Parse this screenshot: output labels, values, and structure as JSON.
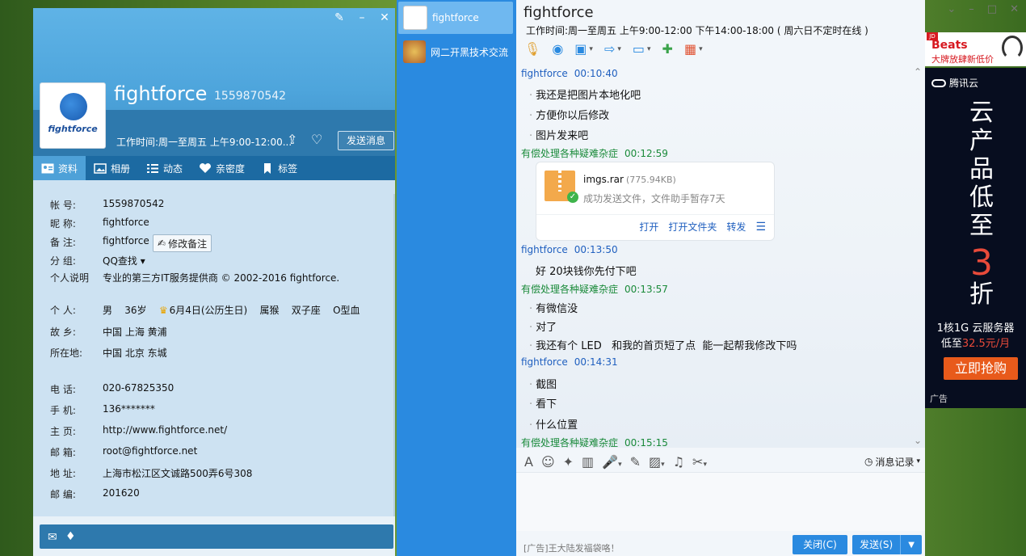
{
  "profile": {
    "name": "fightforce",
    "qq": "1559870542",
    "logo_text": "fightforce",
    "hours": "工作时间:周一至周五 上午9:00-12:00...",
    "send_button": "发送消息",
    "tabs": [
      {
        "label": "资料",
        "icon": "id-card-icon"
      },
      {
        "label": "相册",
        "icon": "photo-icon"
      },
      {
        "label": "动态",
        "icon": "list-icon"
      },
      {
        "label": "亲密度",
        "icon": "heart-icon"
      },
      {
        "label": "标签",
        "icon": "bookmark-icon"
      }
    ],
    "fields": {
      "account": {
        "label": "帐    号:",
        "value": "1559870542"
      },
      "nickname": {
        "label": "昵    称:",
        "value": "fightforce"
      },
      "remark": {
        "label": "备    注:",
        "value": "fightforce"
      },
      "group": {
        "label": "分    组:",
        "value": "QQ查找"
      },
      "bio": {
        "label": "个人说明",
        "value": "专业的第三方IT服务提供商 © 2002-2016 fightforce."
      },
      "personal": {
        "label": "个    人:",
        "gender": "男",
        "age": "36岁",
        "birthday": "6月4日(公历生日)",
        "zodiac": "属猴",
        "sign": "双子座",
        "blood": "O型血"
      },
      "hometown": {
        "label": "故    乡:",
        "value": "中国 上海 黄浦"
      },
      "location": {
        "label": "所在地:",
        "value": "中国 北京 东城"
      },
      "phone": {
        "label": "电    话:",
        "value": "020-67825350"
      },
      "mobile": {
        "label": "手    机:",
        "value": "136*******"
      },
      "homepage": {
        "label": "主    页:",
        "value": "http://www.fightforce.net/"
      },
      "email": {
        "label": "邮    箱:",
        "value": "root@fightforce.net"
      },
      "address": {
        "label": "地    址:",
        "value": "上海市松江区文诚路500弄6号308"
      },
      "postcode": {
        "label": "邮    编:",
        "value": "201620"
      }
    },
    "edit_note_button": "修改备注"
  },
  "sessions": [
    {
      "name": "fightforce",
      "active": true
    },
    {
      "name": "网二开黑技术交流",
      "active": false
    }
  ],
  "chat": {
    "title": "fightforce",
    "hours": "工作时间:周一至周五 上午9:00-12:00 下午14:00-18:00 ( 周六日不定时在线 )",
    "messages": [
      {
        "who": "fightforce",
        "time": "00:10:40",
        "lines": [
          "我还是把图片本地化吧",
          "方便你以后修改",
          "图片发来吧"
        ]
      },
      {
        "who": "有偿处理各种疑难杂症",
        "time": "00:12:59"
      },
      {
        "who": "fightforce",
        "time": "00:13:50",
        "lines": [
          "好 20块钱你先付下吧"
        ]
      },
      {
        "who": "有偿处理各种疑难杂症",
        "time": "00:13:57",
        "lines": [
          "有微信没",
          "对了",
          "我还有个 LED   和我的首页短了点  能一起帮我修改下吗"
        ]
      },
      {
        "who": "fightforce",
        "time": "00:14:31",
        "lines": [
          "截图",
          "看下",
          "什么位置"
        ]
      },
      {
        "who": "有偿处理各种疑难杂症",
        "time": "00:15:15"
      }
    ],
    "file": {
      "name": "imgs.rar",
      "size": "(775.94KB)",
      "status": "成功发送文件，文件助手暂存7天",
      "actions": [
        "打开",
        "打开文件夹",
        "转发"
      ]
    },
    "history_label": "消息记录",
    "ad_text": "[广告]王大陆发福袋咯！",
    "close_button": "关闭(C)",
    "send_button": "发送(S)"
  },
  "ads": {
    "top": {
      "brand": "Beats",
      "tagline": "大牌放肆新低价",
      "jd": "JD"
    },
    "main": {
      "logo": "腾讯云",
      "slogan": [
        "云",
        "产",
        "品",
        "低",
        "至"
      ],
      "discount": "3",
      "unit": "折",
      "spec_line1": "1核1G 云服务器",
      "spec_prefix": "低至",
      "spec_price": "32.5元/月",
      "cta": "立即抢购",
      "label": "广告"
    }
  }
}
